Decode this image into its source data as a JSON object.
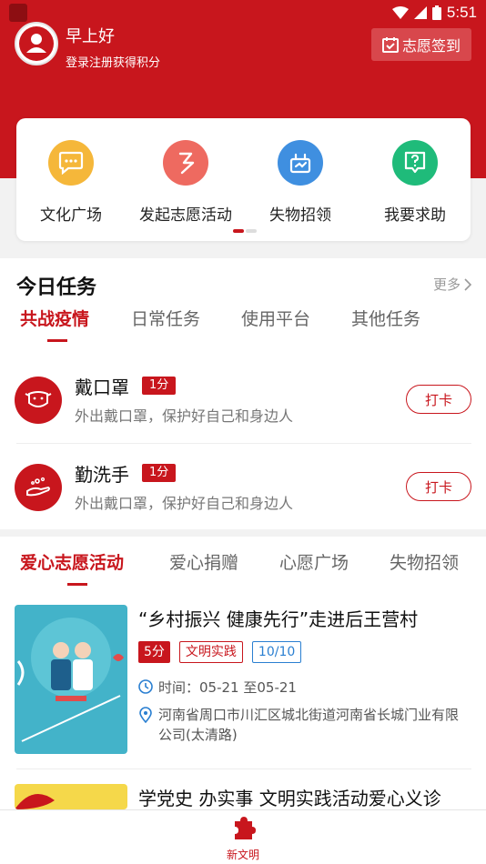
{
  "status_bar": {
    "time": "5:51"
  },
  "user": {
    "greeting": "早上好",
    "subtext": "登录注册获得积分",
    "avatar_icon": "user-avatar-icon"
  },
  "header": {
    "signin_label": "志愿签到",
    "signin_icon": "calendar-check-icon"
  },
  "quick_actions": [
    {
      "label": "文化广场",
      "icon": "chat-bubble-icon",
      "color": "#f5b73a"
    },
    {
      "label": "发起志愿活动",
      "icon": "hand-heart-icon",
      "color": "#ee6a60"
    },
    {
      "label": "失物招领",
      "icon": "found-items-icon",
      "color": "#3f8fe0"
    },
    {
      "label": "我要求助",
      "icon": "help-question-icon",
      "color": "#1fbb7a"
    }
  ],
  "today_tasks": {
    "title": "今日任务",
    "more": "更多",
    "tabs": [
      "共战疫情",
      "日常任务",
      "使用平台",
      "其他任务"
    ],
    "active_tab": 0,
    "items": [
      {
        "name": "戴口罩",
        "points": "1分",
        "desc": "外出戴口罩，保护好自己和身边人",
        "action": "打卡",
        "icon": "mask-icon"
      },
      {
        "name": "勤洗手",
        "points": "1分",
        "desc": "外出戴口罩，保护好自己和身边人",
        "action": "打卡",
        "icon": "hand-wash-icon"
      }
    ]
  },
  "activities": {
    "tabs": [
      "爱心志愿活动",
      "爱心捐赠",
      "心愿广场",
      "失物招领"
    ],
    "active_tab": 0,
    "items": [
      {
        "title": "“乡村振兴 健康先行”走进后王营村",
        "score": "5分",
        "category": "文明实践",
        "quota": "10/10",
        "time": "时间：05-21 至05-21",
        "address": "河南省周口市川汇区城北街道河南省长城门业有限公司(太清路)"
      },
      {
        "title": "学党史 办实事 文明实践活动爱心义诊"
      }
    ]
  },
  "bottom_nav": {
    "label": "新文明",
    "icon": "puzzle-icon"
  },
  "colors": {
    "brand_red": "#c8161d",
    "info_blue": "#2a7fd1"
  }
}
